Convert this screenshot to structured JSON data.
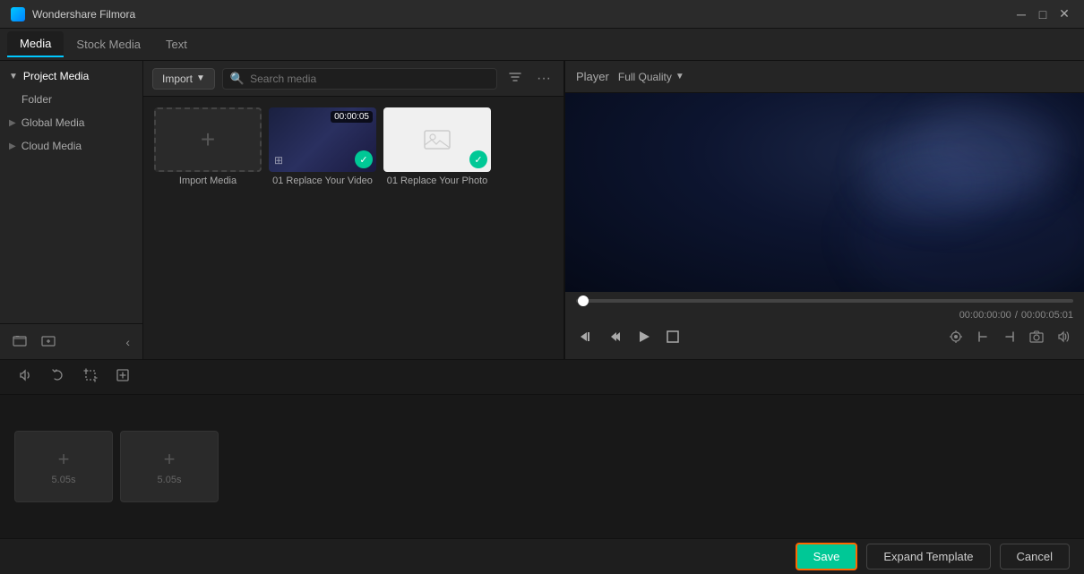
{
  "app": {
    "title": "Wondershare Filmora",
    "icon": "filmora-icon"
  },
  "titlebar": {
    "minimize_label": "─",
    "maximize_label": "□",
    "close_label": "✕"
  },
  "tabs": [
    {
      "id": "media",
      "label": "Media",
      "active": true
    },
    {
      "id": "stock",
      "label": "Stock Media",
      "active": false
    },
    {
      "id": "text",
      "label": "Text",
      "active": false
    }
  ],
  "sidebar": {
    "items": [
      {
        "id": "project-media",
        "label": "Project Media",
        "expanded": true,
        "indent": 0
      },
      {
        "id": "folder",
        "label": "Folder",
        "indent": 1
      },
      {
        "id": "global-media",
        "label": "Global Media",
        "indent": 0
      },
      {
        "id": "cloud-media",
        "label": "Cloud Media",
        "indent": 0
      }
    ]
  },
  "media_toolbar": {
    "import_label": "Import",
    "search_placeholder": "Search media",
    "filter_icon": "filter-icon",
    "more_icon": "more-icon"
  },
  "media_items": [
    {
      "id": "import",
      "type": "import",
      "label": "Import Media"
    },
    {
      "id": "video1",
      "type": "video",
      "label": "01 Replace Your Video",
      "time": "00:00:05",
      "checked": true
    },
    {
      "id": "photo1",
      "type": "photo",
      "label": "01 Replace Your Photo",
      "checked": true
    }
  ],
  "player": {
    "label": "Player",
    "quality": "Full Quality",
    "time_current": "00:00:00:00",
    "time_total": "00:00:05:01",
    "separator": "/"
  },
  "controls": {
    "skip_back": "⏮",
    "frame_back": "⏪",
    "play": "▶",
    "square": "⬜",
    "settings_icon": "⚙",
    "mark_in": "[",
    "mark_out": "]",
    "snapshot": "📷",
    "volume": "🔊"
  },
  "bottom_toolbar": {
    "tools": [
      {
        "id": "audio",
        "icon": "🔊"
      },
      {
        "id": "rotate",
        "icon": "↻"
      },
      {
        "id": "crop",
        "icon": "⊕"
      },
      {
        "id": "transform",
        "icon": "⬡"
      }
    ]
  },
  "timeline": {
    "clips": [
      {
        "id": "clip1",
        "duration": "5.05s"
      },
      {
        "id": "clip2",
        "duration": "5.05s"
      }
    ]
  },
  "footer": {
    "save_label": "Save",
    "expand_label": "Expand Template",
    "cancel_label": "Cancel"
  },
  "left_footer": {
    "new_folder": "📁",
    "collapse": "‹"
  }
}
